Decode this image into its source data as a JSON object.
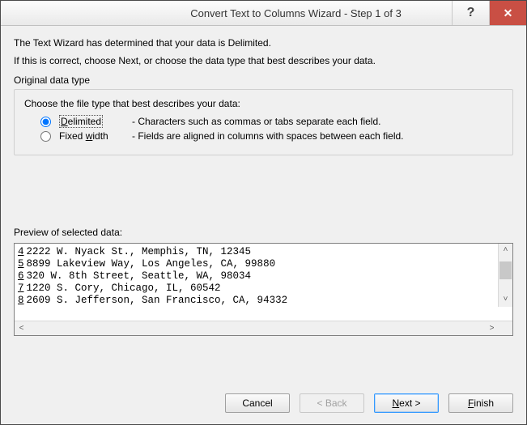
{
  "window": {
    "title": "Convert Text to Columns Wizard - Step 1 of 3"
  },
  "intro": {
    "line1": "The Text Wizard has determined that your data is Delimited.",
    "line2": "If this is correct, choose Next, or choose the data type that best describes your data."
  },
  "group": {
    "heading": "Original data type",
    "choose": "Choose the file type that best describes your data:",
    "options": {
      "delimited": {
        "label_pre": "D",
        "label_rest": "elimited",
        "desc": "- Characters such as commas or tabs separate each field."
      },
      "fixed": {
        "label_pre": "Fixed ",
        "label_u": "w",
        "label_rest": "idth",
        "desc": "- Fields are aligned in columns with spaces between each field."
      }
    }
  },
  "preview": {
    "label": "Preview of selected data:",
    "rows": [
      {
        "n": "4",
        "text": "2222 W. Nyack St., Memphis, TN, 12345"
      },
      {
        "n": "5",
        "text": "8899 Lakeview Way, Los Angeles, CA, 99880"
      },
      {
        "n": "6",
        "text": "320 W. 8th Street, Seattle, WA, 98034"
      },
      {
        "n": "7",
        "text": "1220 S. Cory, Chicago, IL, 60542"
      },
      {
        "n": "8",
        "text": "2609 S. Jefferson, San Francisco, CA, 94332"
      }
    ]
  },
  "buttons": {
    "cancel": "Cancel",
    "back": "< Back",
    "next_pre": "N",
    "next_rest": "ext >",
    "finish_pre": "F",
    "finish_rest": "inish"
  }
}
